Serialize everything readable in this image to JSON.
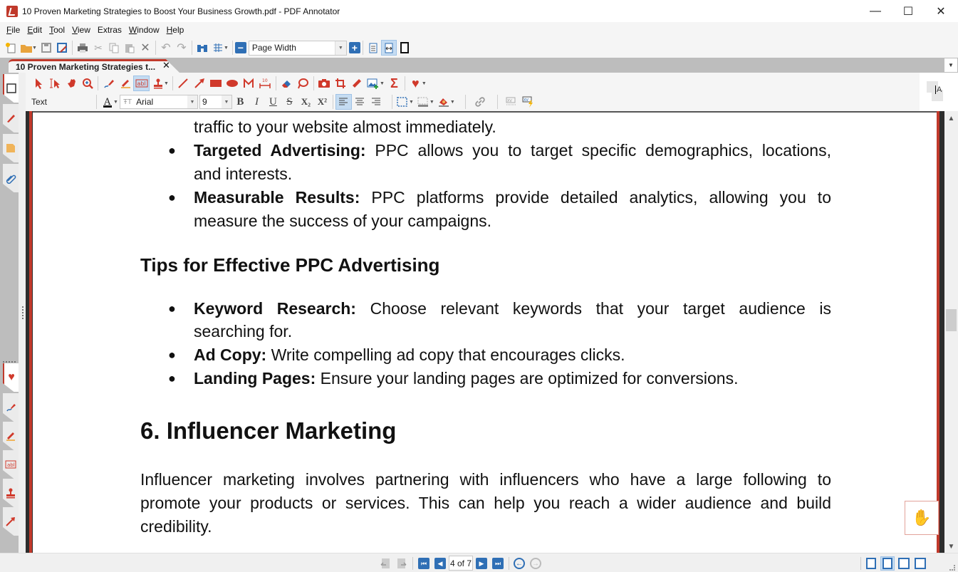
{
  "window": {
    "title": "10 Proven Marketing Strategies to Boost Your Business Growth.pdf - PDF Annotator",
    "minimize": "—",
    "maximize": "☐",
    "close": "✕"
  },
  "menu": [
    {
      "label": "File",
      "key": "F",
      "rest": "ile"
    },
    {
      "label": "Edit",
      "key": "E",
      "rest": "dit"
    },
    {
      "label": "Tool",
      "key": "T",
      "rest": "ool"
    },
    {
      "label": "View",
      "key": "V",
      "rest": "iew"
    },
    {
      "label": "Extras",
      "key": "Ex",
      "rest": "tras"
    },
    {
      "label": "Window",
      "key": "W",
      "rest": "indow"
    },
    {
      "label": "Help",
      "key": "H",
      "rest": "elp"
    }
  ],
  "toolbar": {
    "zoom_value": "Page Width",
    "zoom_out": "−",
    "zoom_in": "+"
  },
  "tab": {
    "label": "10 Proven Marketing Strategies t...",
    "close": "✕"
  },
  "annotation_toolbar": {
    "type_label": "Text",
    "font": "Arial",
    "size": "9",
    "bold": "B",
    "italic": "I",
    "underline": "U",
    "strike": "S",
    "subscript": "X₂",
    "superscript": "X²"
  },
  "document": {
    "lines": [
      {
        "text": "traffic to your website almost immediately."
      },
      {
        "bold": "Targeted Advertising:",
        "text": " PPC allows you to target specific demographics, locations,"
      },
      {
        "text": "and interests."
      },
      {
        "bold": "Measurable Results:",
        "text": " PPC platforms provide detailed analytics, allowing you to"
      },
      {
        "text": "measure the success of your campaigns."
      }
    ],
    "tips_heading": "Tips for Effective PPC Advertising",
    "tips": [
      {
        "bold": "Keyword Research:",
        "text": " Choose relevant keywords that your target audience is",
        "cont": "searching for."
      },
      {
        "bold": "Ad Copy:",
        "text": " Write compelling ad copy that encourages clicks."
      },
      {
        "bold": "Landing Pages:",
        "text": " Ensure your landing pages are optimized for conversions."
      }
    ],
    "section_heading": "6. Influencer Marketing",
    "paragraph": [
      "Influencer marketing involves partnering with influencers who have a large following to",
      "promote your products or services. This can help you reach a wider audience and build",
      "credibility."
    ],
    "bullet_char": "●"
  },
  "status": {
    "page_display": "4 of 7"
  },
  "colors": {
    "accent": "#c0392b",
    "nav_blue": "#2f6fb5"
  }
}
